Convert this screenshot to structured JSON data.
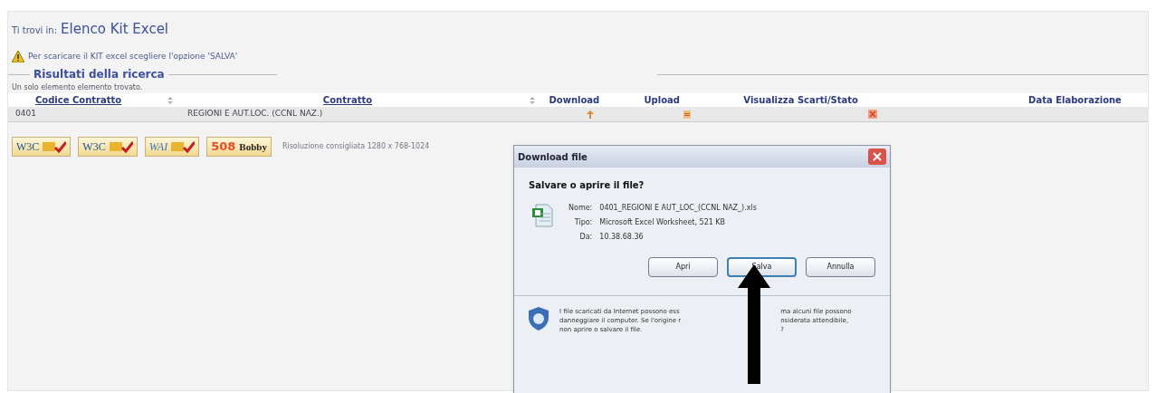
{
  "breadcrumb": {
    "label": "Ti trovi in:",
    "current": "Elenco Kit Excel"
  },
  "notice": "Per scaricare il KIT excel scegliere l'opzione 'SALVA'",
  "results": {
    "legend": "Risultati della ricerca",
    "count": "Un solo elemento elemento trovato.",
    "columns": [
      {
        "label": "Codice Contratto",
        "sortable": true
      },
      {
        "label": "Contratto",
        "sortable": true
      },
      {
        "label": "Download",
        "sortable": false
      },
      {
        "label": "Upload",
        "sortable": false
      },
      {
        "label": "Visualizza Scarti/Stato",
        "sortable": false
      },
      {
        "label": "Data Elaborazione",
        "sortable": false
      }
    ],
    "rows": [
      {
        "code": "0401",
        "contract": "REGIONI E AUT.LOC. (CCNL NAZ.)"
      }
    ]
  },
  "badges": [
    {
      "kind": "w3c",
      "mark": "W3C"
    },
    {
      "kind": "w3c",
      "mark": "W3C"
    },
    {
      "kind": "wai",
      "mark": "WAI"
    },
    {
      "kind": "bobby",
      "mark": "508",
      "brand": "Bobby"
    }
  ],
  "resolution": "Risoluzione consigliata 1280 x 768-1024",
  "dialog": {
    "title": "Download file",
    "question": "Salvare o aprire il file?",
    "fields": [
      {
        "label": "Nome:",
        "value": "0401_REGIONI E AUT_LOC_(CCNL NAZ_).xls"
      },
      {
        "label": "Tipo:",
        "value": "Microsoft Excel Worksheet, 521 KB"
      },
      {
        "label": "Da:",
        "value": "10.38.68.36"
      }
    ],
    "buttons": [
      {
        "label": "Apri",
        "selected": false
      },
      {
        "label": "Salva",
        "selected": true
      },
      {
        "label": "Annulla",
        "selected": false
      }
    ],
    "warning_left": [
      "I file scaricati da Internet possono ess",
      "danneggiare il computer. Se l'origine r",
      "non aprire o salvare il file."
    ],
    "warning_right": [
      "ma alcuni file possono",
      "nsiderata attendibile,",
      "?"
    ]
  }
}
